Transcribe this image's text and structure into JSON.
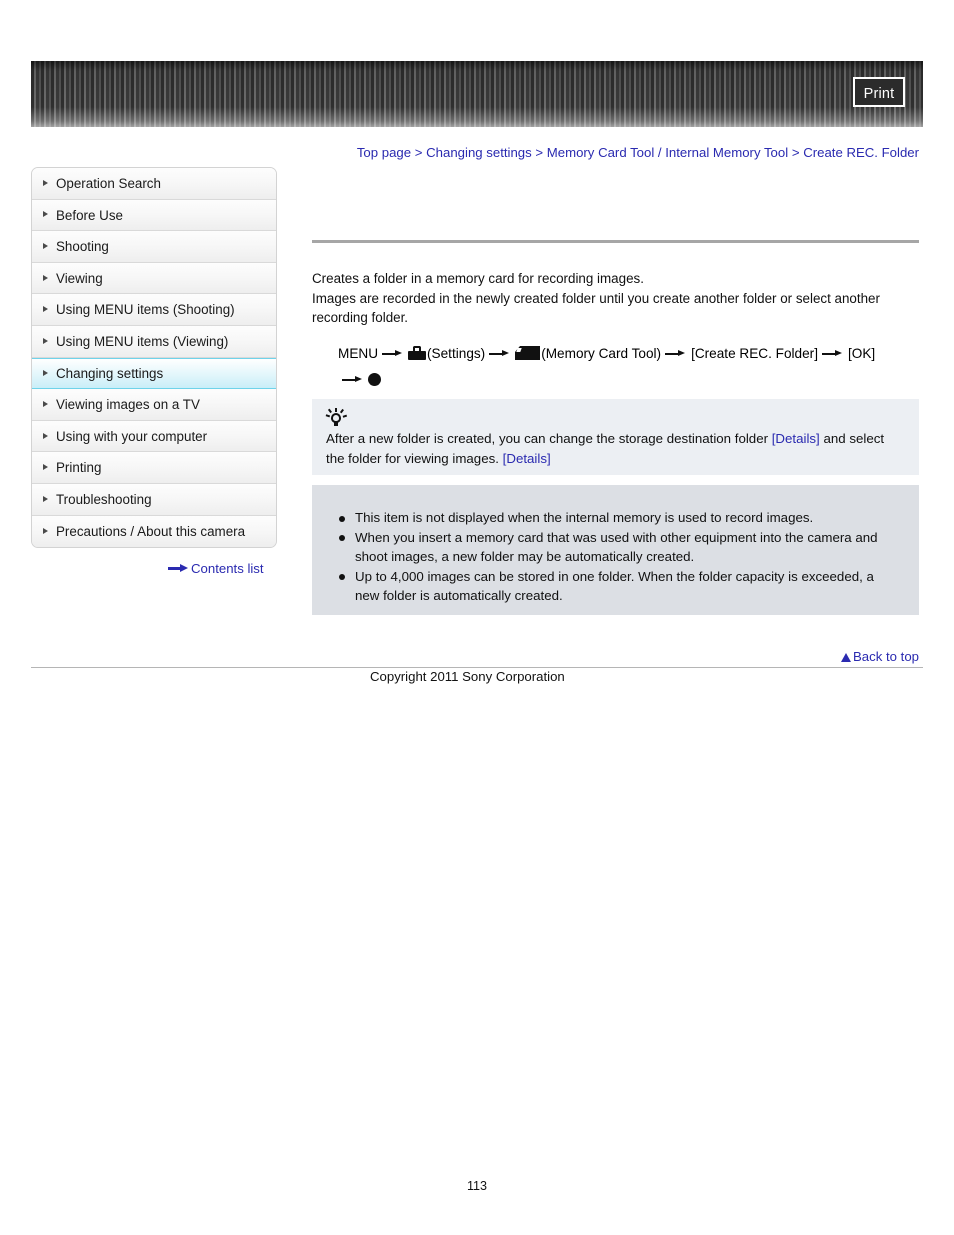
{
  "header": {
    "print_label": "Print"
  },
  "breadcrumb": {
    "items": [
      {
        "label": "Top page",
        "link": true
      },
      {
        "label": "Changing settings",
        "link": true
      },
      {
        "label": "Memory Card Tool / Internal Memory Tool",
        "link": true
      },
      {
        "label": "Create REC. Folder",
        "link": true
      }
    ],
    "separator": ">",
    "full_text": "Top page > Changing settings > Memory Card Tool / Internal Memory Tool > Create REC. Folder"
  },
  "sidebar": {
    "items": [
      {
        "label": "Operation Search",
        "active": false
      },
      {
        "label": "Before Use",
        "active": false
      },
      {
        "label": "Shooting",
        "active": false
      },
      {
        "label": "Viewing",
        "active": false
      },
      {
        "label": "Using MENU items (Shooting)",
        "active": false
      },
      {
        "label": "Using MENU items (Viewing)",
        "active": false
      },
      {
        "label": "Changing settings",
        "active": true
      },
      {
        "label": "Viewing images on a TV",
        "active": false
      },
      {
        "label": "Using with your computer",
        "active": false
      },
      {
        "label": "Printing",
        "active": false
      },
      {
        "label": "Troubleshooting",
        "active": false
      },
      {
        "label": "Precautions / About this camera",
        "active": false
      }
    ],
    "contents_link": "Contents list",
    "active_color": "#c9eef8",
    "active_border_color": "#6fd3ea"
  },
  "main": {
    "paragraph1": "Creates a folder in a memory card for recording images.",
    "paragraph2": "Images are recorded in the newly created folder until you create another folder or select another recording folder.",
    "menu_path": {
      "menu_label": "MENU",
      "settings_label": "(Settings)",
      "memory_card_tool_label": "(Memory Card Tool)",
      "create_rec_folder_label": "[Create REC. Folder]",
      "ok_label": "[OK]",
      "settings_icon": "toolbox-icon",
      "memory_card_icon": "memory-card-icon",
      "shutter_icon": "shutter-button-icon",
      "arrow_icon": "right-arrow-icon"
    }
  },
  "tip": {
    "icon": "lightbulb-icon",
    "text_part1": "After a new folder is created, you can change the storage destination folder ",
    "link1": "[Details]",
    "text_part2": " and select the folder for viewing images. ",
    "link2": "[Details]",
    "background": "#eceff3"
  },
  "notes": {
    "background": "#dcdfe4",
    "items": [
      "This item is not displayed when the internal memory is used to record images.",
      "When you insert a memory card that was used with other equipment into the camera and shoot images, a new folder may be automatically created.",
      "Up to 4,000 images can be stored in one folder. When the folder capacity is exceeded, a new folder is automatically created."
    ]
  },
  "footer": {
    "back_to_top": "Back to top",
    "copyright": "Copyright 2011 Sony Corporation",
    "page_number": "113",
    "link_color": "#2a2ab0"
  }
}
